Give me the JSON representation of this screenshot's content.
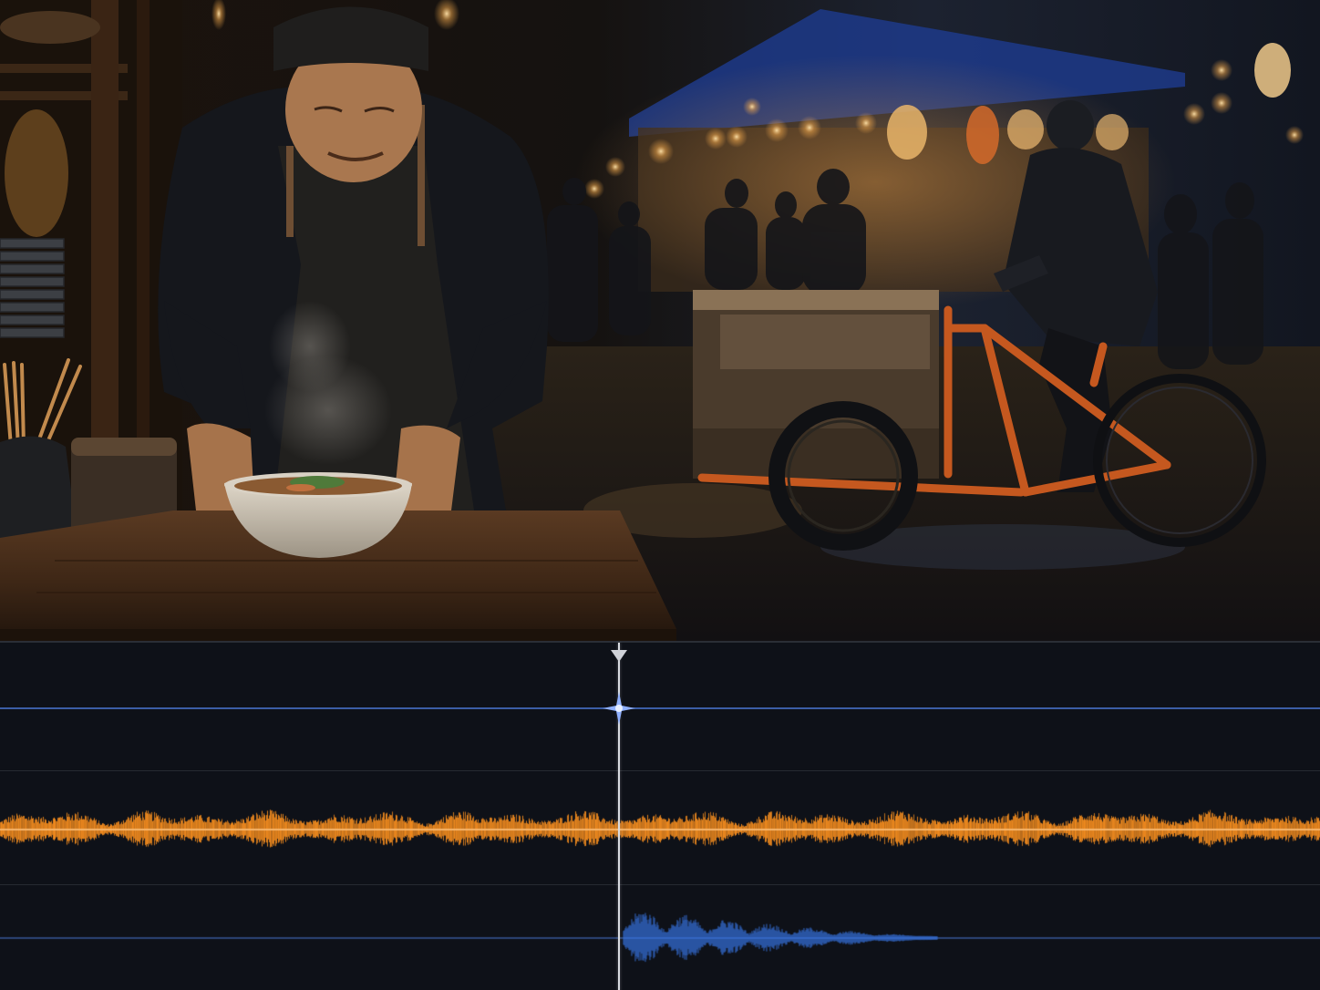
{
  "preview": {
    "scene": "night-market-ramen-chef-video-frame"
  },
  "timeline": {
    "playhead_fraction": 0.469,
    "tracks": [
      {
        "id": "video-track",
        "color": "#5b8dff",
        "kind": "keyframe-line"
      },
      {
        "id": "music-track",
        "color": "#f08a1e",
        "kind": "waveform",
        "start_fraction": 0.0,
        "end_fraction": 1.0
      },
      {
        "id": "voice-track",
        "color": "#3a78e8",
        "kind": "waveform",
        "start_fraction": 0.472,
        "end_fraction": 0.71
      }
    ]
  },
  "colors": {
    "background": "#0e1118",
    "playhead": "#d8dbe0",
    "music_wave": "#f08a1e",
    "voice_wave": "#3a78e8",
    "guide_line": "#4a78d6"
  }
}
